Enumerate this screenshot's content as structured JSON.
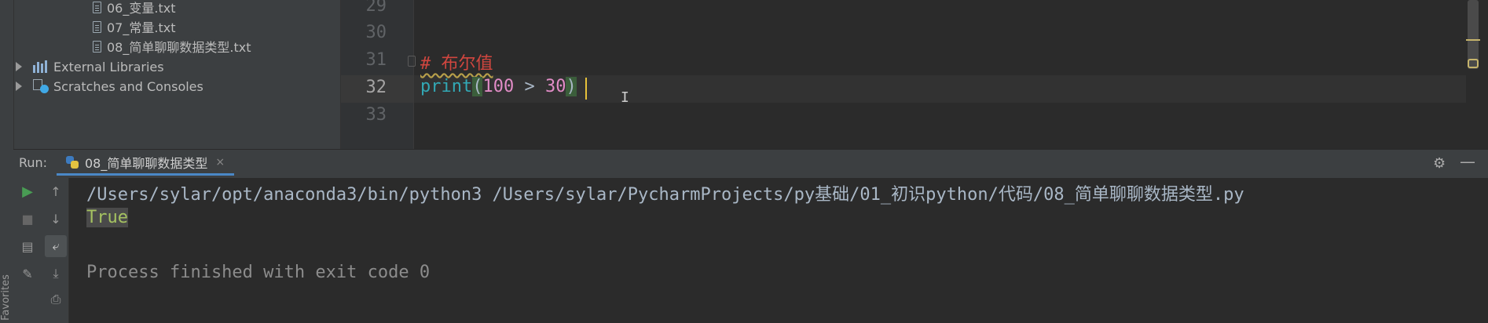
{
  "sidebar": {
    "favorites_label": "Favorites"
  },
  "project_tree": {
    "files": [
      {
        "name": "06_变量.txt"
      },
      {
        "name": "07_常量.txt"
      },
      {
        "name": "08_简单聊聊数据类型.txt"
      }
    ],
    "nodes": [
      {
        "name": "External Libraries"
      },
      {
        "name": "Scratches and Consoles"
      }
    ]
  },
  "editor": {
    "line_numbers": [
      "29",
      "30",
      "31",
      "32",
      "33"
    ],
    "comment": "# 布尔值",
    "code": {
      "func": "print",
      "open": "(",
      "left": "100",
      "op": " > ",
      "right": "30",
      "close": ")"
    }
  },
  "run_panel": {
    "label": "Run:",
    "tab_name": "08_简单聊聊数据类型",
    "close_glyph": "×",
    "command": "/Users/sylar/opt/anaconda3/bin/python3 /Users/sylar/PycharmProjects/py基础/01_初识python/代码/08_简单聊聊数据类型.py",
    "output": "True",
    "exit_message": "Process finished with exit code 0"
  },
  "colors": {
    "accent": "#4a88c7",
    "comment": "#d0463f",
    "number": "#e18cc6",
    "builtin": "#32a8b5"
  }
}
